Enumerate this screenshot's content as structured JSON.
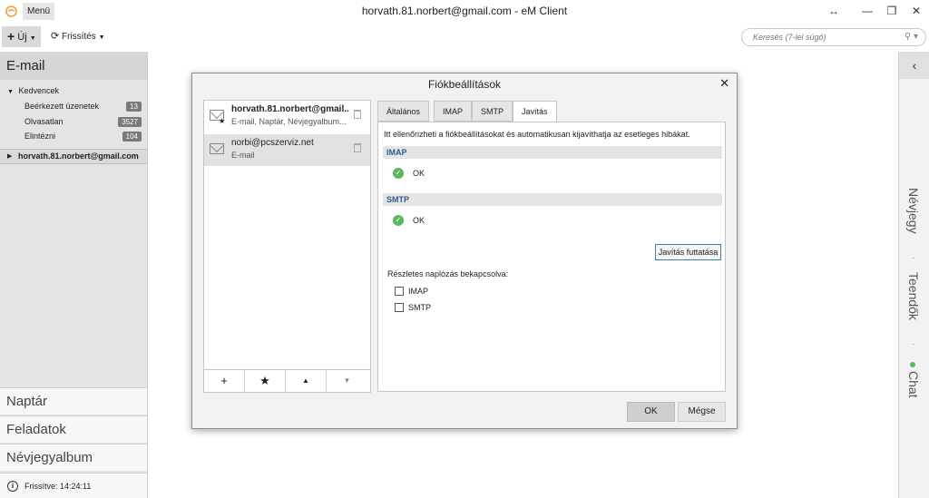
{
  "window": {
    "title": "horvath.81.norbert@gmail.com - eM Client",
    "menu_label": "Menü"
  },
  "toolbar": {
    "new_label": "Új",
    "refresh_label": "Frissítés",
    "search_placeholder": "Keresés (7-lel súgó)"
  },
  "sidebar": {
    "header": "E-mail",
    "favorites_label": "Kedvencek",
    "favorites": [
      {
        "label": "Beérkezett üzenetek",
        "count": "13"
      },
      {
        "label": "Olvasatlan",
        "count": "3527"
      },
      {
        "label": "Elintézni",
        "count": "104"
      }
    ],
    "account": "horvath.81.norbert@gmail.com",
    "sections": [
      "Naptár",
      "Feladatok",
      "Névjegyalbum"
    ],
    "status": "Frissítve: 14:24:11"
  },
  "right_panel": {
    "items": [
      "Névjegy",
      "Teendők",
      "Chat"
    ]
  },
  "dialog": {
    "title": "Fiókbeállítások",
    "accounts": [
      {
        "name": "horvath.81.norbert@gmail...",
        "sub": "E-mail, Naptár, Névjegyalbum..."
      },
      {
        "name": "norbi@pcszerviz.net",
        "sub": "E-mail"
      }
    ],
    "tabs": [
      "Általános",
      "IMAP",
      "SMTP",
      "Javítás"
    ],
    "intro": "Itt ellenőrizheti a fiókbeállításokat és automatikusan kijavíthatja az esetleges hibákat.",
    "imap_header": "IMAP",
    "imap_status": "OK",
    "smtp_header": "SMTP",
    "smtp_status": "OK",
    "repair_button": "Javítás futtatása",
    "log_label": "Részletes naplózás bekapcsolva:",
    "log_options": [
      "IMAP",
      "SMTP"
    ],
    "ok_button": "OK",
    "cancel_button": "Mégse"
  }
}
